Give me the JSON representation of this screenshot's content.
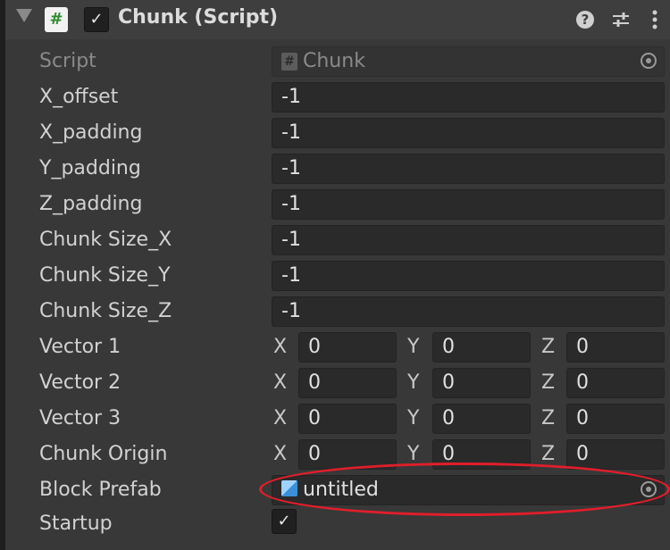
{
  "header": {
    "title": "Chunk (Script)",
    "script_icon_glyph": "#",
    "enabled_check": "✓",
    "help_glyph": "?",
    "accent_color": "#2e8b2e"
  },
  "fields": {
    "script": {
      "label": "Script",
      "value": "Chunk",
      "icon_glyph": "#"
    },
    "x_offset": {
      "label": "X_offset",
      "value": "-1"
    },
    "x_padding": {
      "label": "X_padding",
      "value": "-1"
    },
    "y_padding": {
      "label": "Y_padding",
      "value": "-1"
    },
    "z_padding": {
      "label": "Z_padding",
      "value": "-1"
    },
    "chunk_size_x": {
      "label": "Chunk Size_X",
      "value": "-1"
    },
    "chunk_size_y": {
      "label": "Chunk Size_Y",
      "value": "-1"
    },
    "chunk_size_z": {
      "label": "Chunk Size_Z",
      "value": "-1"
    }
  },
  "vectors": [
    {
      "label": "Vector 1",
      "x": "0",
      "y": "0",
      "z": "0"
    },
    {
      "label": "Vector 2",
      "x": "0",
      "y": "0",
      "z": "0"
    },
    {
      "label": "Vector 3",
      "x": "0",
      "y": "0",
      "z": "0"
    },
    {
      "label": "Chunk Origin",
      "x": "0",
      "y": "0",
      "z": "0"
    }
  ],
  "axis_labels": {
    "x": "X",
    "y": "Y",
    "z": "Z"
  },
  "block_prefab": {
    "label": "Block Prefab",
    "value": "untitled"
  },
  "startup": {
    "label": "Startup",
    "check": "✓"
  },
  "annotation": {
    "color": "#e01e2b"
  }
}
